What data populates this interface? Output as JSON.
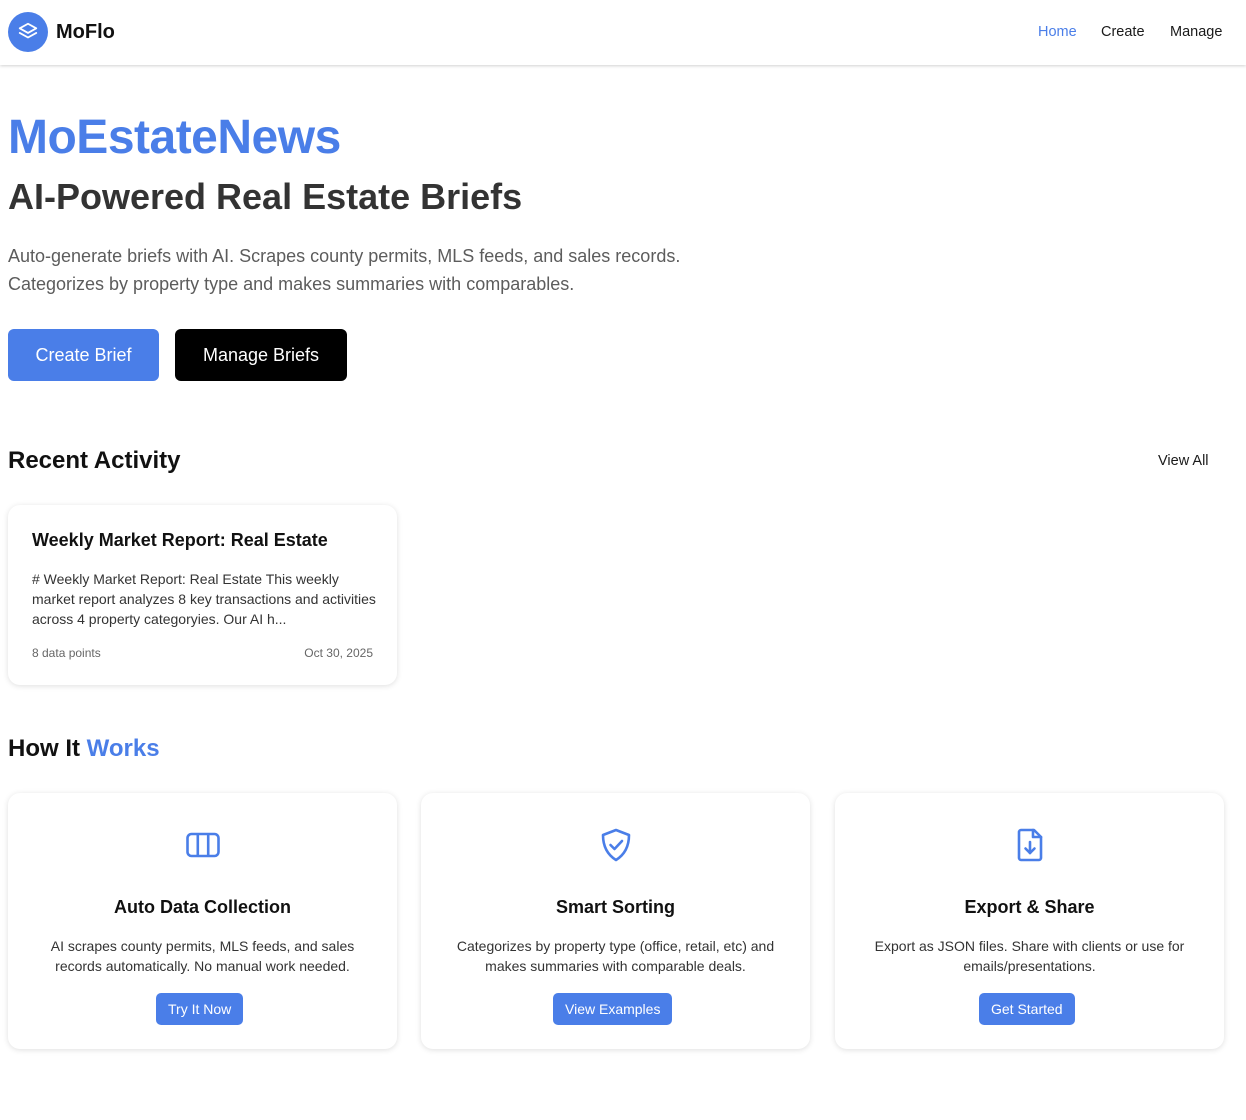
{
  "app": {
    "brand": "MoFlo",
    "nav": [
      {
        "label": "Home",
        "active": true
      },
      {
        "label": "Create",
        "active": false
      },
      {
        "label": "Manage",
        "active": false
      }
    ],
    "accent_color": "#4a7ee8"
  },
  "hero": {
    "title": "MoEstateNews",
    "subtitle": "AI-Powered Real Estate Briefs",
    "description": "Auto-generate briefs with AI. Scrapes county permits, MLS feeds, and sales records. Categorizes by property type and makes summaries with comparables.",
    "primary_button": "Create Brief",
    "secondary_button": "Manage Briefs"
  },
  "recent_activity": {
    "heading": "Recent Activity",
    "view_all": "View All",
    "items": [
      {
        "title": "Weekly Market Report: Real Estate",
        "excerpt": "# Weekly Market Report: Real Estate This weekly market report analyzes 8 key transactions and activities across 4 property categoryies. Our AI h...",
        "data_points": "8 data points",
        "date": "Oct 30, 2025"
      }
    ]
  },
  "how_it_works": {
    "heading_plain": "How It ",
    "heading_accent": "Works",
    "features": [
      {
        "icon": "columns-icon",
        "title": "Auto Data Collection",
        "description": "AI scrapes county permits, MLS feeds, and sales records automatically. No manual work needed.",
        "button": "Try It Now"
      },
      {
        "icon": "shield-check-icon",
        "title": "Smart Sorting",
        "description": "Categorizes by property type (office, retail, etc) and makes summaries with comparable deals.",
        "button": "View Examples"
      },
      {
        "icon": "file-download-icon",
        "title": "Export & Share",
        "description": "Export as JSON files. Share with clients or use for emails/presentations.",
        "button": "Get Started"
      }
    ]
  }
}
